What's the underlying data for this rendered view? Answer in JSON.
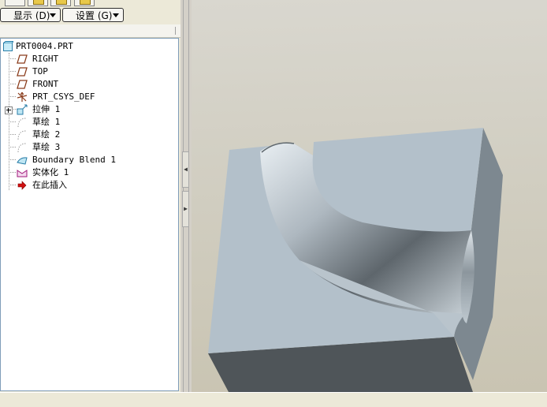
{
  "navigator": {
    "toolbar": {
      "display_button": "显示 (D)",
      "settings_button": "设置 (G)"
    },
    "tree": {
      "root": "PRT0004.PRT",
      "items": [
        {
          "label": "RIGHT",
          "icon": "datum-plane-icon"
        },
        {
          "label": "TOP",
          "icon": "datum-plane-icon"
        },
        {
          "label": "FRONT",
          "icon": "datum-plane-icon"
        },
        {
          "label": "PRT_CSYS_DEF",
          "icon": "coordinate-system-icon"
        },
        {
          "label": "拉伸 1",
          "icon": "extrude-icon"
        },
        {
          "label": "草绘 1",
          "icon": "sketch-icon"
        },
        {
          "label": "草绘 2",
          "icon": "sketch-icon"
        },
        {
          "label": "草绘 3",
          "icon": "sketch-icon"
        },
        {
          "label": "Boundary Blend 1",
          "icon": "boundary-blend-icon"
        },
        {
          "label": "实体化 1",
          "icon": "solidify-icon"
        },
        {
          "label": "在此插入",
          "icon": "insert-here-arrow-icon"
        }
      ]
    }
  },
  "viewport": {
    "model": "solid block with curved boundary-blend groove",
    "colors": {
      "top_face": "#b3c0ca",
      "right_face": "#7d8890",
      "front_face": "#4f5559",
      "background": "#d2cfc3"
    }
  }
}
